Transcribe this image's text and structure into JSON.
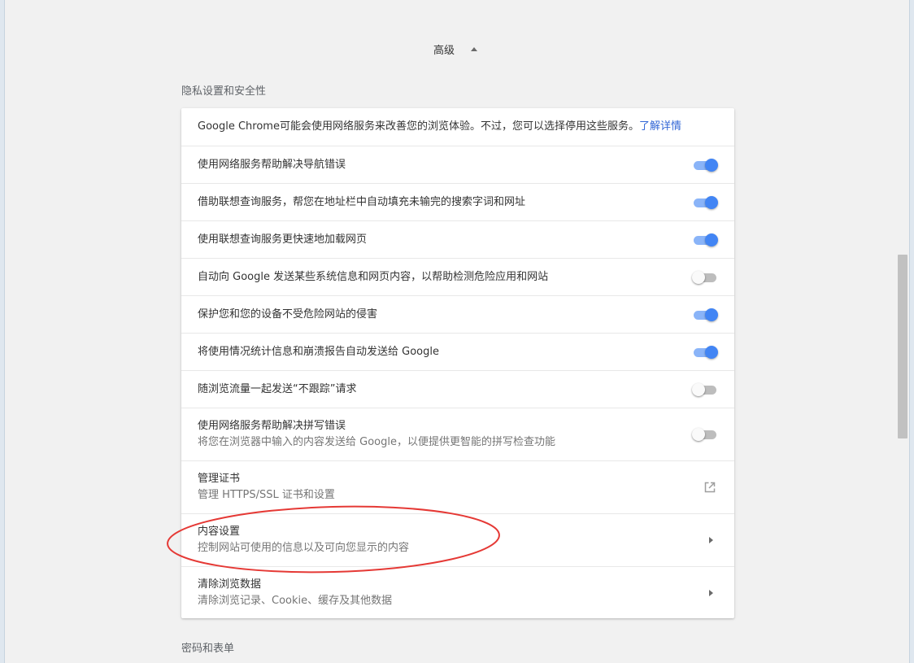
{
  "advanced": {
    "label": "高级"
  },
  "sections": {
    "privacy_title": "隐私设置和安全性",
    "passwords_title": "密码和表单"
  },
  "privacy": {
    "intro_text": "Google Chrome可能会使用网络服务来改善您的浏览体验。不过，您可以选择停用这些服务。",
    "intro_link": "了解详情",
    "toggles": [
      {
        "label": "使用网络服务帮助解决导航错误",
        "on": true
      },
      {
        "label": "借助联想查询服务，帮您在地址栏中自动填充未输完的搜索字词和网址",
        "on": true
      },
      {
        "label": "使用联想查询服务更快速地加载网页",
        "on": true
      },
      {
        "label": "自动向 Google 发送某些系统信息和网页内容，以帮助检测危险应用和网站",
        "on": false
      },
      {
        "label": "保护您和您的设备不受危险网站的侵害",
        "on": true
      },
      {
        "label": "将使用情况统计信息和崩溃报告自动发送给 Google",
        "on": true
      },
      {
        "label": "随浏览流量一起发送“不跟踪”请求",
        "on": false
      }
    ],
    "spell": {
      "label": "使用网络服务帮助解决拼写错误",
      "sublabel": "将您在浏览器中输入的内容发送给 Google，以便提供更智能的拼写检查功能",
      "on": false
    },
    "certificates": {
      "label": "管理证书",
      "sublabel": "管理 HTTPS/SSL 证书和设置",
      "icon": "open-in-new-icon"
    },
    "content_settings": {
      "label": "内容设置",
      "sublabel": "控制网站可使用的信息以及可向您显示的内容",
      "icon": "chevron-right-icon"
    },
    "clear_data": {
      "label": "清除浏览数据",
      "sublabel": "清除浏览记录、Cookie、缓存及其他数据",
      "icon": "chevron-right-icon"
    }
  },
  "colors": {
    "toggle_on": "#4285f4",
    "link": "#3367d6",
    "annotation": "#e53935"
  }
}
